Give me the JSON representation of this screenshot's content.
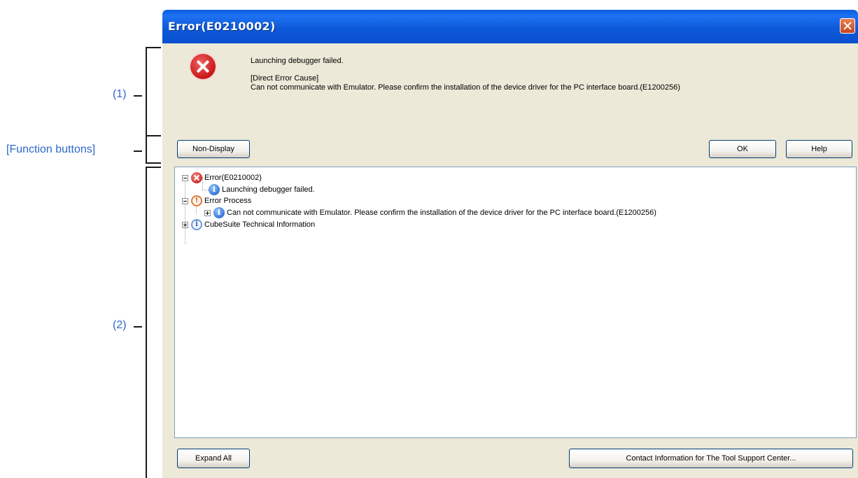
{
  "dialog": {
    "title": "Error(E0210002)",
    "message": {
      "summary": "Launching debugger failed.",
      "cause_heading": "[Direct Error Cause]",
      "cause_text": "Can not communicate with Emulator. Please confirm the installation of the device driver for the PC interface board.(E1200256)"
    },
    "buttons": {
      "non_display": "Non-Display",
      "ok": "OK",
      "help": "Help",
      "expand_all": "Expand All",
      "contact": "Contact Information for The Tool Support Center..."
    },
    "tree": [
      {
        "label": "Error(E0210002)",
        "icon": "error-icon",
        "expanded": true
      },
      {
        "label": "Launching debugger failed.",
        "icon": "info-icon"
      },
      {
        "label": "Error Process",
        "icon": "warning-icon",
        "expanded": true
      },
      {
        "label": "Can not communicate with Emulator. Please confirm the installation of the device driver for the PC interface board.(E1200256)",
        "icon": "info-icon",
        "expanded": false
      },
      {
        "label": "CubeSuite Technical Information",
        "icon": "info-outline-icon",
        "expanded": false
      }
    ]
  },
  "annotations": {
    "area1": "(1)",
    "function_buttons": "[Function buttons]",
    "area2": "(2)"
  },
  "colors": {
    "annotation_text": "#2f68c8",
    "titlebar": "#0a5be0",
    "dialog_background": "#ece9d8"
  }
}
